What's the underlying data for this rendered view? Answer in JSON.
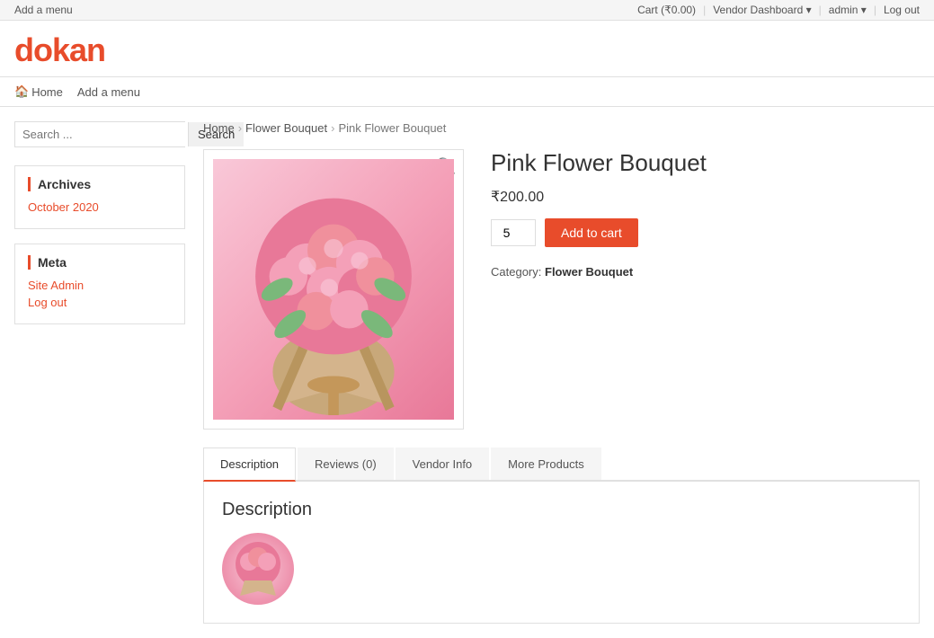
{
  "topbar": {
    "left_label": "Add a menu",
    "cart_label": "Cart (₹0.00)",
    "vendor_dashboard_label": "Vendor Dashboard",
    "vendor_dashboard_arrow": "▾",
    "admin_label": "admin",
    "admin_arrow": "▾",
    "logout_label": "Log out"
  },
  "header": {
    "logo_prefix": "d",
    "logo_text": "okan"
  },
  "nav": {
    "home_icon": "🏠",
    "home_label": "Home",
    "add_menu_label": "Add a menu"
  },
  "sidebar": {
    "search_placeholder": "Search ...",
    "search_button": "Search",
    "archives_title": "Archives",
    "archives_items": [
      {
        "label": "October 2020",
        "href": "#"
      }
    ],
    "meta_title": "Meta",
    "meta_items": [
      {
        "label": "Site Admin",
        "href": "#"
      },
      {
        "label": "Log out",
        "href": "#"
      }
    ]
  },
  "breadcrumb": {
    "home": "Home",
    "category": "Flower Bouquet",
    "current": "Pink Flower Bouquet"
  },
  "product": {
    "title": "Pink Flower Bouquet",
    "price": "₹200.00",
    "quantity": "5",
    "add_to_cart": "Add to cart",
    "category_label": "Category:",
    "category_value": "Flower Bouquet"
  },
  "tabs": [
    {
      "id": "description",
      "label": "Description",
      "active": true
    },
    {
      "id": "reviews",
      "label": "Reviews (0)",
      "active": false
    },
    {
      "id": "vendor-info",
      "label": "Vendor Info",
      "active": false
    },
    {
      "id": "more-products",
      "label": "More Products",
      "active": false
    }
  ],
  "tab_content": {
    "description_title": "Description"
  },
  "colors": {
    "accent": "#e84c2b",
    "link": "#e84c2b"
  }
}
